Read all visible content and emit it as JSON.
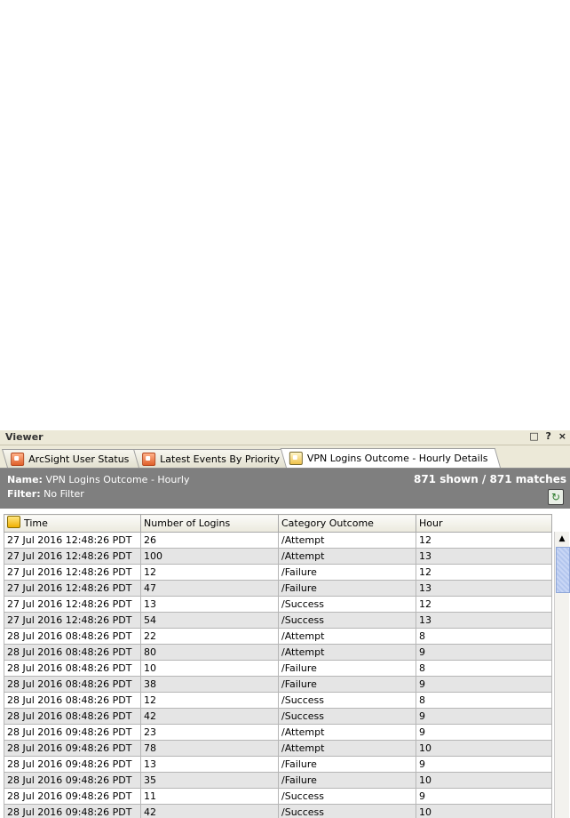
{
  "viewer": {
    "title": "Viewer",
    "controls": {
      "restore": "□↗",
      "help": "?",
      "close": "×"
    }
  },
  "tabs": [
    {
      "label": "ArcSight User Status",
      "icon": "dashboard-icon"
    },
    {
      "label": "Latest Events By Priority",
      "icon": "dashboard-icon"
    },
    {
      "label": "VPN Logins Outcome - Hourly Details",
      "icon": "query-viewer-icon",
      "active": true
    }
  ],
  "info": {
    "name_label": "Name:",
    "name_value": "VPN Logins Outcome - Hourly",
    "filter_label": "Filter:",
    "filter_value": "No Filter",
    "matches": "871 shown / 871 matches"
  },
  "table": {
    "columns": [
      "Time",
      "Number of Logins",
      "Category Outcome",
      "Hour"
    ],
    "rows": [
      [
        "27 Jul 2016 12:48:26 PDT",
        "26",
        "/Attempt",
        "12"
      ],
      [
        "27 Jul 2016 12:48:26 PDT",
        "100",
        "/Attempt",
        "13"
      ],
      [
        "27 Jul 2016 12:48:26 PDT",
        "12",
        "/Failure",
        "12"
      ],
      [
        "27 Jul 2016 12:48:26 PDT",
        "47",
        "/Failure",
        "13"
      ],
      [
        "27 Jul 2016 12:48:26 PDT",
        "13",
        "/Success",
        "12"
      ],
      [
        "27 Jul 2016 12:48:26 PDT",
        "54",
        "/Success",
        "13"
      ],
      [
        "28 Jul 2016 08:48:26 PDT",
        "22",
        "/Attempt",
        "8"
      ],
      [
        "28 Jul 2016 08:48:26 PDT",
        "80",
        "/Attempt",
        "9"
      ],
      [
        "28 Jul 2016 08:48:26 PDT",
        "10",
        "/Failure",
        "8"
      ],
      [
        "28 Jul 2016 08:48:26 PDT",
        "38",
        "/Failure",
        "9"
      ],
      [
        "28 Jul 2016 08:48:26 PDT",
        "12",
        "/Success",
        "8"
      ],
      [
        "28 Jul 2016 08:48:26 PDT",
        "42",
        "/Success",
        "9"
      ],
      [
        "28 Jul 2016 09:48:26 PDT",
        "23",
        "/Attempt",
        "9"
      ],
      [
        "28 Jul 2016 09:48:26 PDT",
        "78",
        "/Attempt",
        "10"
      ],
      [
        "28 Jul 2016 09:48:26 PDT",
        "13",
        "/Failure",
        "9"
      ],
      [
        "28 Jul 2016 09:48:26 PDT",
        "35",
        "/Failure",
        "10"
      ],
      [
        "28 Jul 2016 09:48:26 PDT",
        "11",
        "/Success",
        "9"
      ],
      [
        "28 Jul 2016 09:48:26 PDT",
        "42",
        "/Success",
        "10"
      ]
    ]
  }
}
